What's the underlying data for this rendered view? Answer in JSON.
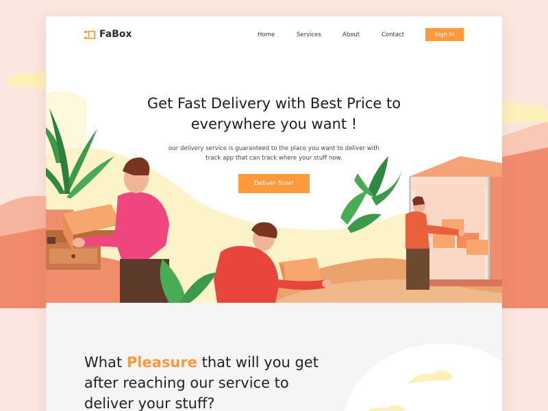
{
  "brand": {
    "name": "FaBox",
    "accent": "#ff9a3c"
  },
  "nav": {
    "items": [
      {
        "label": "Home"
      },
      {
        "label": "Services"
      },
      {
        "label": "About"
      },
      {
        "label": "Contact"
      }
    ],
    "signin_label": "Sign In"
  },
  "hero": {
    "title_line1": "Get Fast Delivery with Best Price to",
    "title_line2": "everywhere you want !",
    "subtitle_line1": "our delivery service is guaranteed to the place you want to deliver with",
    "subtitle_line2": "track app that can track where your stuff now.",
    "cta_label": "Deliver Now!"
  },
  "section2": {
    "heading_pre": "What ",
    "heading_accent": "Pleasure",
    "heading_post": " that will you get",
    "heading_line2": "after reaching our service to",
    "heading_line3": "deliver your stuff?"
  },
  "icons": [
    "logo-icon",
    "delivery-illustration",
    "cloud-icon",
    "plant-icon",
    "box-icon"
  ],
  "colors": {
    "accent": "#ff9a3c",
    "background": "#fbe7df",
    "hero_sand": "#fdf3c8",
    "pink_shirt": "#f0467f",
    "red_shirt": "#e8453c"
  }
}
